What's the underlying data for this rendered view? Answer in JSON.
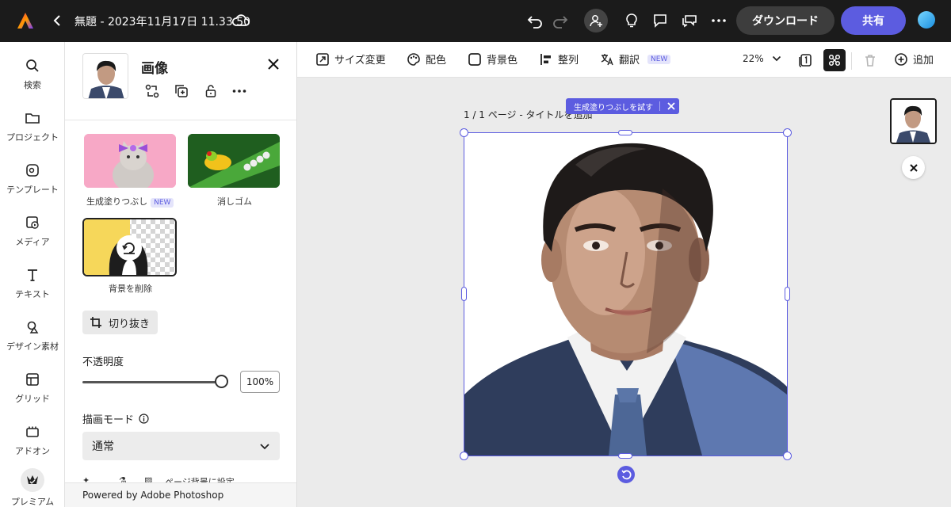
{
  "app": {
    "doc_title": "無題 - 2023年11月17日 11.33.50",
    "download_label": "ダウンロード",
    "share_label": "共有"
  },
  "rail": {
    "items": [
      {
        "label": "検索",
        "icon": "search-icon"
      },
      {
        "label": "プロジェクト",
        "icon": "folder-icon"
      },
      {
        "label": "テンプレート",
        "icon": "template-icon"
      },
      {
        "label": "メディア",
        "icon": "media-icon"
      },
      {
        "label": "テキスト",
        "icon": "text-icon"
      },
      {
        "label": "デザイン素材",
        "icon": "shapes-icon"
      },
      {
        "label": "グリッド",
        "icon": "grid-icon"
      },
      {
        "label": "アドオン",
        "icon": "addon-icon"
      },
      {
        "label": "プレミアム",
        "icon": "premium-crown-icon"
      }
    ]
  },
  "panel": {
    "title": "画像",
    "effects": [
      {
        "label": "生成塗りつぶし",
        "badge": "NEW"
      },
      {
        "label": "消しゴム"
      },
      {
        "label": "背景を削除"
      }
    ],
    "crop_label": "切り抜き",
    "opacity_label": "不透明度",
    "opacity_value": "100%",
    "opacity_fraction": 1.0,
    "blend_label": "描画モード",
    "blend_value": "通常",
    "cut_text": "ページ背景に設定",
    "powered_by": "Powered by Adobe Photoshop"
  },
  "toolbar": {
    "resize": "サイズ変更",
    "palette": "配色",
    "bgcolor": "背景色",
    "align": "整列",
    "translate": "翻訳",
    "translate_badge": "NEW",
    "zoom": "22%",
    "add": "追加"
  },
  "canvas": {
    "page_label": "1 / 1 ページ - タイトルを追加",
    "gen_fill_pill": "生成塗りつぶしを試す"
  },
  "colors": {
    "accent": "#5c5ce0",
    "topbar": "#1b1b1b"
  }
}
